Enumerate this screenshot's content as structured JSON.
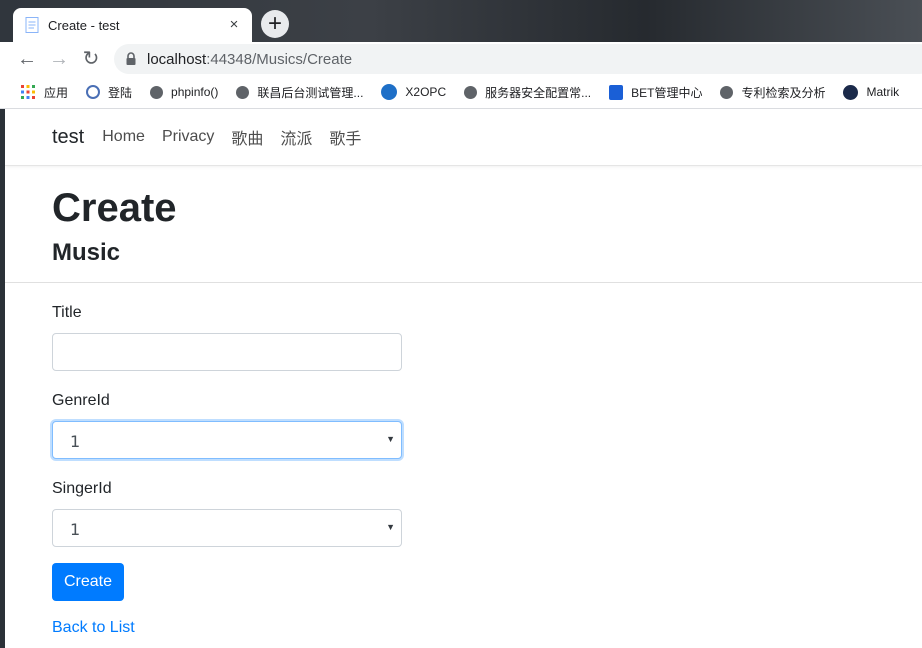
{
  "browser": {
    "tab_title": "Create - test",
    "tab_close": "×",
    "new_tab": "+",
    "url_host": "localhost",
    "url_rest": ":44348/Musics/Create",
    "nav": {
      "back": "←",
      "forward": "→",
      "reload": "↻"
    },
    "bookmarks": [
      {
        "label": "应用",
        "icon": "apps-grid-icon"
      },
      {
        "label": "登陆",
        "icon": "globe-icon"
      },
      {
        "label": "phpinfo()",
        "icon": "globe-icon"
      },
      {
        "label": "联昌后台测试管理...",
        "icon": "globe-icon"
      },
      {
        "label": "X2OPC",
        "icon": "swirl-icon"
      },
      {
        "label": "服务器安全配置常...",
        "icon": "globe-icon"
      },
      {
        "label": "BET管理中心",
        "icon": "book-icon"
      },
      {
        "label": "专利检索及分析",
        "icon": "globe-icon"
      },
      {
        "label": "Matrik",
        "icon": "wave-icon"
      }
    ]
  },
  "navbar": {
    "brand": "test",
    "links": [
      "Home",
      "Privacy",
      "歌曲",
      "流派",
      "歌手"
    ]
  },
  "main": {
    "heading": "Create",
    "subheading": "Music",
    "title_label": "Title",
    "title_value": "",
    "genre_label": "GenreId",
    "genre_value": "1",
    "singer_label": "SingerId",
    "singer_value": "1",
    "submit_label": "Create",
    "back_link": "Back to List"
  },
  "colors": {
    "primary": "#007bff",
    "focus_border": "#80bdff"
  }
}
